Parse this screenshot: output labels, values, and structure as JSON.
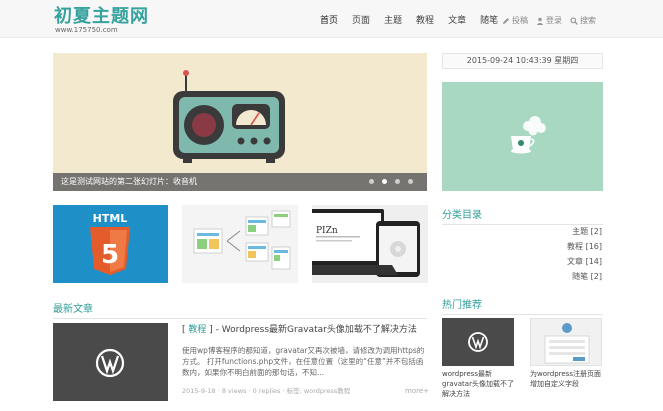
{
  "header": {
    "logo_title": "初夏主题网",
    "logo_url": "www.175750.com",
    "nav": [
      "首页",
      "页面",
      "主题",
      "教程",
      "文章",
      "随笔"
    ],
    "tools": [
      {
        "icon": "pencil-icon",
        "label": "投稿"
      },
      {
        "icon": "user-icon",
        "label": "登录"
      },
      {
        "icon": "search-icon",
        "label": "搜索"
      }
    ]
  },
  "slider": {
    "caption": "这是测试网站的第二张幻灯片：收音机",
    "dot_count": 4,
    "active_dot": 2
  },
  "datetime": "2015-09-24 10:43:39 星期四",
  "categories": {
    "title": "分类目录",
    "items": [
      {
        "name": "主题",
        "count": "[2]"
      },
      {
        "name": "教程",
        "count": "[16]"
      },
      {
        "name": "文章",
        "count": "[14]"
      },
      {
        "name": "随笔",
        "count": "[2]"
      }
    ]
  },
  "latest": {
    "title": "最新文章",
    "post": {
      "bracket_open": "[",
      "category": "教程",
      "bracket_close": "]",
      "title": "- Wordpress最新Gravatar头像加载不了解决方法",
      "excerpt": "使用wp博客程序的都知道，gravatar又再次被墙，请修改为调用https的方式。 打开functions.php文件，在任意位置（这里的“任意”并不包括函数内，如果你不明白前面的那句话，不知...",
      "meta": "2015-9-18 · 8 views · 0 replies · 标签: wordpress教程",
      "more": "more+"
    }
  },
  "hot": {
    "title": "热门推荐",
    "items": [
      {
        "caption": "wordpress最新gravatar头像加载不了解决方法"
      },
      {
        "caption": "为wordpress注册页面增加自定义字段"
      }
    ]
  },
  "thumbs": {
    "html_label": "HTML",
    "shield_label": "5",
    "laptop_text": "PIZn"
  },
  "colors": {
    "accent": "#2f9e99",
    "slider_bg": "#f2e9cf",
    "mint": "#a8d8c1"
  }
}
